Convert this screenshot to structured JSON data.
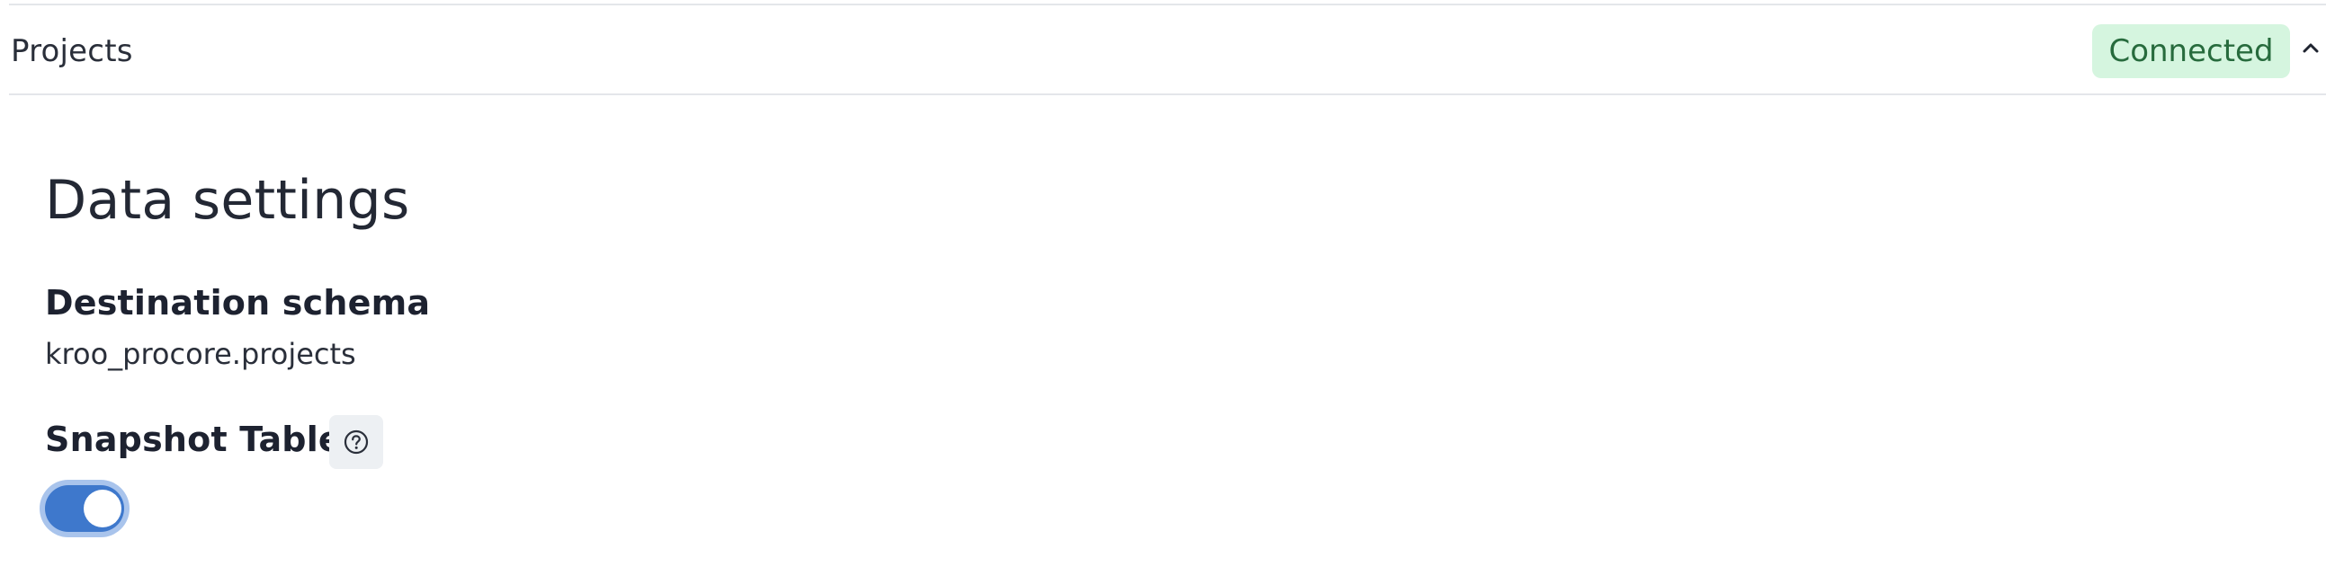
{
  "accordion": {
    "title": "Projects",
    "status": "Connected",
    "status_color": "#d5f5df",
    "status_text_color": "#276b3d",
    "expanded": true,
    "toggle_icon": "chevron-up-icon"
  },
  "data_settings": {
    "heading": "Data settings",
    "destination_schema": {
      "label": "Destination schema",
      "value": "kroo_procore.projects"
    },
    "snapshot_table": {
      "label": "Snapshot Table",
      "help_icon": "question-circle-icon",
      "enabled": true,
      "toggle_color": "#3e78cc"
    }
  }
}
